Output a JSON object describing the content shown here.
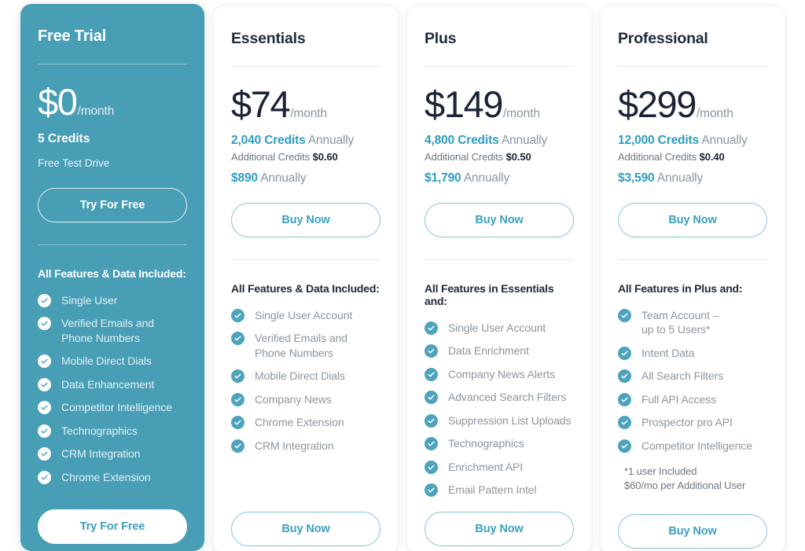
{
  "plans": [
    {
      "id": "free-trial",
      "name": "Free Trial",
      "price": "$0",
      "period": "/month",
      "credits_headline": "5 Credits",
      "subtitle": "Free Test Drive",
      "cta_top": "Try For Free",
      "cta_bottom": "Try For Free",
      "features_heading": "All Features & Data Included:",
      "features": [
        "Single User",
        "Verified Emails and Phone Numbers",
        "Mobile Direct Dials",
        "Data Enhancement",
        "Competitor Intelligence",
        "Technographics",
        "CRM Integration",
        "Chrome Extension"
      ],
      "footnote": ""
    },
    {
      "id": "essentials",
      "name": "Essentials",
      "price": "$74",
      "period": "/month",
      "credits_amount": "2,040 Credits",
      "credits_suffix": " Annually",
      "additional_label": "Additional Credits ",
      "additional_value": "$0.60",
      "annual_price": "$890",
      "annual_suffix": " Annually",
      "cta_top": "Buy Now",
      "cta_bottom": "Buy Now",
      "features_heading": "All Features & Data Included:",
      "features": [
        "Single User Account",
        "Verified Emails and Phone Numbers",
        "Mobile Direct Dials",
        "Company News",
        "Chrome Extension",
        "CRM Integration"
      ],
      "footnote": ""
    },
    {
      "id": "plus",
      "name": "Plus",
      "price": "$149",
      "period": "/month",
      "credits_amount": "4,800 Credits",
      "credits_suffix": " Annually",
      "additional_label": "Additional Credits ",
      "additional_value": "$0.50",
      "annual_price": "$1,790",
      "annual_suffix": " Annually",
      "cta_top": "Buy Now",
      "cta_bottom": "Buy Now",
      "features_heading": "All Features in Essentials and:",
      "features": [
        "Single User Account",
        "Data Enrichment",
        "Company News Alerts",
        "Advanced Search Filters",
        "Suppression List Uploads",
        "Technographics",
        "Enrichment API",
        "Email Pattern Intel"
      ],
      "footnote": ""
    },
    {
      "id": "professional",
      "name": "Professional",
      "price": "$299",
      "period": "/month",
      "credits_amount": "12,000 Credits",
      "credits_suffix": " Annually",
      "additional_label": "Additional Credits ",
      "additional_value": "$0.40",
      "annual_price": "$3,590",
      "annual_suffix": " Annually",
      "cta_top": "Buy Now",
      "cta_bottom": "Buy Now",
      "features_heading": "All Features in Plus and:",
      "features": [
        "Team Account –\nup to 5 Users*",
        "Intent Data",
        "All Search Filters",
        "Full API Access",
        "Prospector pro API",
        "Competitor Intelligence"
      ],
      "footnote": "*1 user Included\n$60/mo per Additional User"
    }
  ],
  "colors": {
    "featured_background": "#479eb5",
    "accent_teal": "#2e9cc0",
    "check_teal": "#4da3bd",
    "heading_dark": "#212b3b",
    "muted_gray": "#8d969e"
  }
}
